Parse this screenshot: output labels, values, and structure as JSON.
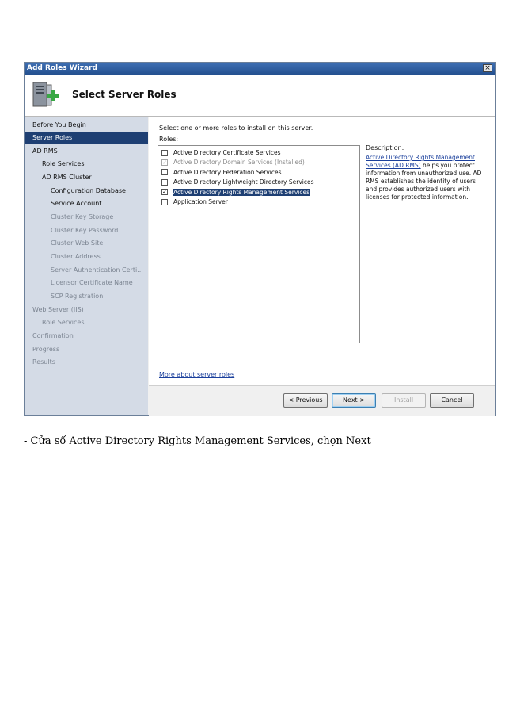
{
  "window": {
    "title": "Add Roles Wizard",
    "close_label": "×",
    "header_title": "Select Server Roles"
  },
  "nav": [
    {
      "label": "Before You Begin",
      "indent": 0,
      "state": "normal"
    },
    {
      "label": "Server Roles",
      "indent": 0,
      "state": "selected"
    },
    {
      "label": "AD RMS",
      "indent": 0,
      "state": "normal"
    },
    {
      "label": "Role Services",
      "indent": 1,
      "state": "normal"
    },
    {
      "label": "AD RMS Cluster",
      "indent": 1,
      "state": "normal"
    },
    {
      "label": "Configuration Database",
      "indent": 2,
      "state": "normal"
    },
    {
      "label": "Service Account",
      "indent": 2,
      "state": "normal"
    },
    {
      "label": "Cluster Key Storage",
      "indent": 2,
      "state": "dim"
    },
    {
      "label": "Cluster Key Password",
      "indent": 2,
      "state": "dim"
    },
    {
      "label": "Cluster Web Site",
      "indent": 2,
      "state": "dim"
    },
    {
      "label": "Cluster Address",
      "indent": 2,
      "state": "dim"
    },
    {
      "label": "Server Authentication Certi...",
      "indent": 2,
      "state": "dim"
    },
    {
      "label": "Licensor Certificate Name",
      "indent": 2,
      "state": "dim"
    },
    {
      "label": "SCP Registration",
      "indent": 2,
      "state": "dim"
    },
    {
      "label": "Web Server (IIS)",
      "indent": 0,
      "state": "dim"
    },
    {
      "label": "Role Services",
      "indent": 1,
      "state": "dim"
    },
    {
      "label": "Confirmation",
      "indent": 0,
      "state": "dim"
    },
    {
      "label": "Progress",
      "indent": 0,
      "state": "dim"
    },
    {
      "label": "Results",
      "indent": 0,
      "state": "dim"
    }
  ],
  "content": {
    "instruction": "Select one or more roles to install on this server.",
    "roles_label": "Roles:",
    "roles": [
      {
        "label": "Active Directory Certificate Services",
        "checked": false,
        "disabled": false,
        "selected": false
      },
      {
        "label": "Active Directory Domain Services  (Installed)",
        "checked": true,
        "disabled": true,
        "selected": false
      },
      {
        "label": "Active Directory Federation Services",
        "checked": false,
        "disabled": false,
        "selected": false
      },
      {
        "label": "Active Directory Lightweight Directory Services",
        "checked": false,
        "disabled": false,
        "selected": false
      },
      {
        "label": "Active Directory Rights Management Services",
        "checked": true,
        "disabled": false,
        "selected": true
      },
      {
        "label": "Application Server",
        "checked": false,
        "disabled": false,
        "selected": false
      }
    ],
    "more_link": "More about server roles",
    "description_label": "Description:",
    "description_link": "Active Directory Rights Management Services (AD RMS)",
    "description_text": " helps you protect information from unauthorized use. AD RMS establishes the identity of users and provides authorized users with licenses for protected information."
  },
  "buttons": {
    "previous": "< Previous",
    "next": "Next >",
    "install": "Install",
    "cancel": "Cancel"
  },
  "caption": "- Cửa sổ Active Directory Rights Management  Services, chọn Next",
  "colors": {
    "selection": "#1e3f73",
    "nav_bg": "#d4dbe6",
    "link": "#1a3f9c"
  }
}
